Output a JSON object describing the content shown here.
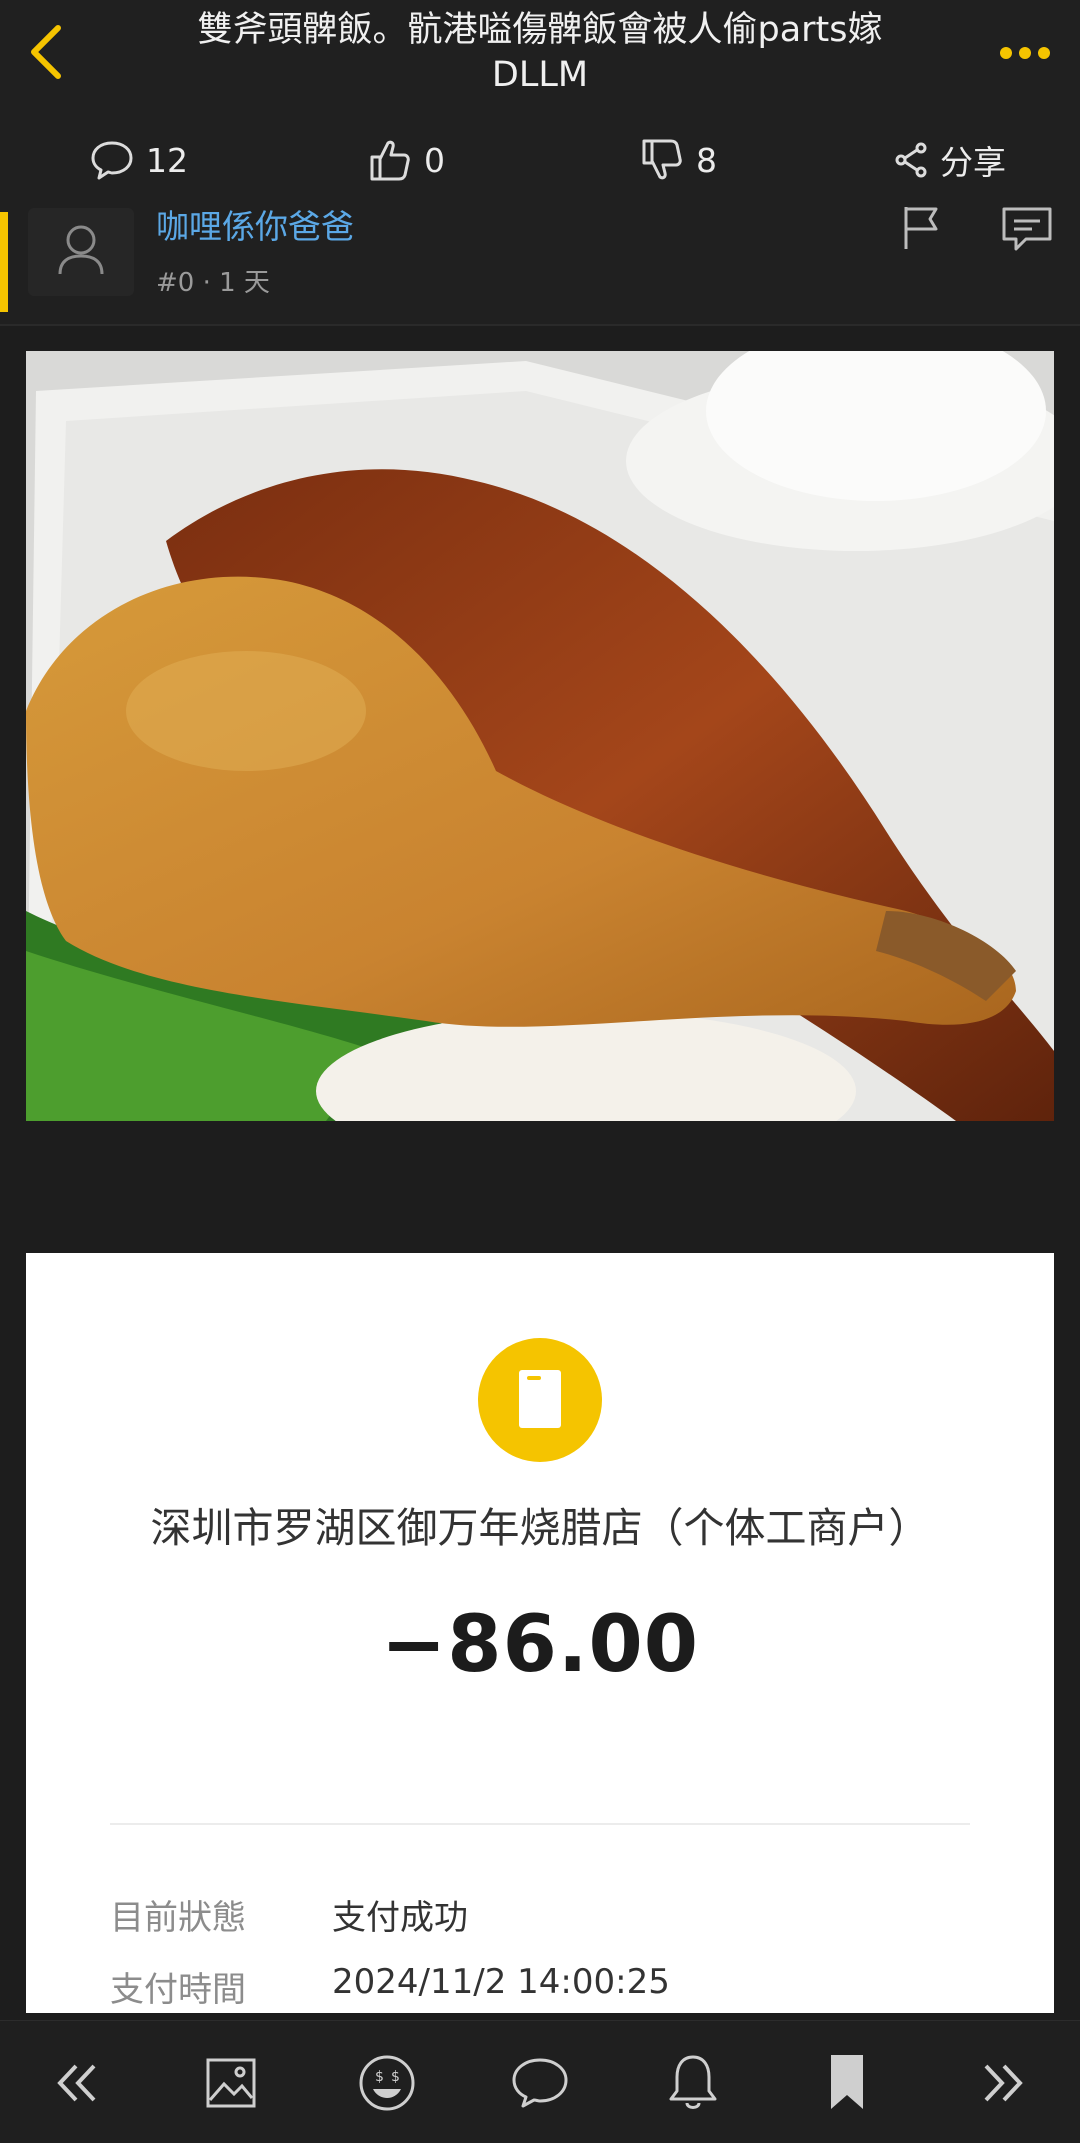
{
  "header": {
    "title": "雙斧頭髀飯。骯港嗌傷髀飯會被人偷parts嫁DLLM",
    "back_icon": "chevron-left-icon",
    "more_icon": "more-dots-icon",
    "accent_color": "#f5c400"
  },
  "stats": {
    "comments": "12",
    "likes": "0",
    "dislikes": "8",
    "share_label": "分享"
  },
  "post": {
    "username": "咖哩係你爸爸",
    "post_number": "#0",
    "age": "· 1 天",
    "username_color": "#5ba8e6"
  },
  "receipt": {
    "merchant": "深圳市罗湖区御万年烧腊店（个体工商户）",
    "amount": "−86.00",
    "rows": [
      {
        "label": "目前狀態",
        "value": "支付成功"
      },
      {
        "label": "支付時間",
        "value": "2024/11/2 14:00:25"
      }
    ]
  },
  "bottom_nav": {
    "items": [
      "double-chevron-left-icon",
      "image-icon",
      "emoji-icon",
      "comment-icon",
      "bell-icon",
      "bookmark-icon",
      "double-chevron-right-icon"
    ]
  }
}
